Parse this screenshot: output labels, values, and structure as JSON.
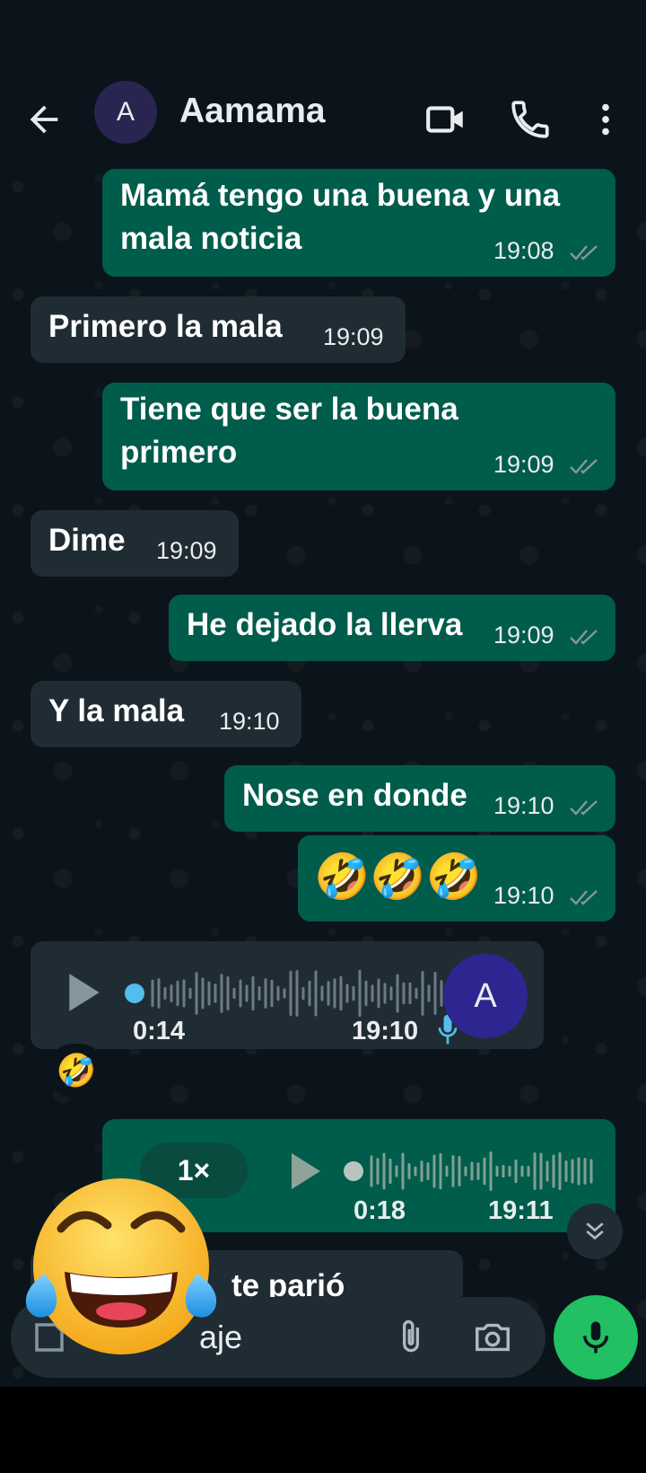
{
  "header": {
    "avatar_letter": "A",
    "contact_name": "Aamama"
  },
  "messages": [
    {
      "dir": "out",
      "text_lines": [
        "Mamá tengo una buena y una",
        "mala noticia"
      ],
      "time": "19:08",
      "status": "read"
    },
    {
      "dir": "in",
      "text": "Primero la mala",
      "time": "19:09"
    },
    {
      "dir": "out",
      "text_lines": [
        "Tiene que ser la buena",
        "primero"
      ],
      "time": "19:09",
      "status": "read"
    },
    {
      "dir": "in",
      "text": "Dime",
      "time": "19:09"
    },
    {
      "dir": "out",
      "text": "He dejado la llerva",
      "time": "19:09",
      "status": "read"
    },
    {
      "dir": "in",
      "text": "Y la mala",
      "time": "19:10"
    },
    {
      "dir": "out",
      "text": "Nose en donde",
      "time": "19:10",
      "status": "read"
    },
    {
      "dir": "out",
      "text": "🤣🤣🤣",
      "time": "19:10",
      "status": "read"
    }
  ],
  "voice_in": {
    "duration": "0:14",
    "time": "19:10",
    "avatar_letter": "A",
    "reaction": "🤣",
    "progress": 0.0
  },
  "voice_out": {
    "speed": "1×",
    "duration": "0:18",
    "time": "19:11",
    "progress": 0.0
  },
  "partial_message": {
    "visible_text": "te parió"
  },
  "composer": {
    "visible_text": "aje"
  },
  "colors": {
    "outgoing_bubble": "#005c4b",
    "incoming_bubble": "#202c33",
    "background": "#0b141a",
    "mic_button": "#21c063",
    "read_ticks": "#8696a0",
    "voice_dot_in": "#53bdeb"
  },
  "icons": {
    "back": "arrow-left-icon",
    "video": "video-camera-icon",
    "call": "phone-icon",
    "menu": "more-vertical-icon",
    "scroll": "double-chevron-down-icon",
    "sticker": "sticker-icon",
    "attach": "paperclip-icon",
    "camera": "camera-icon",
    "mic": "microphone-icon",
    "overlay": "tears-of-joy-emoji"
  }
}
